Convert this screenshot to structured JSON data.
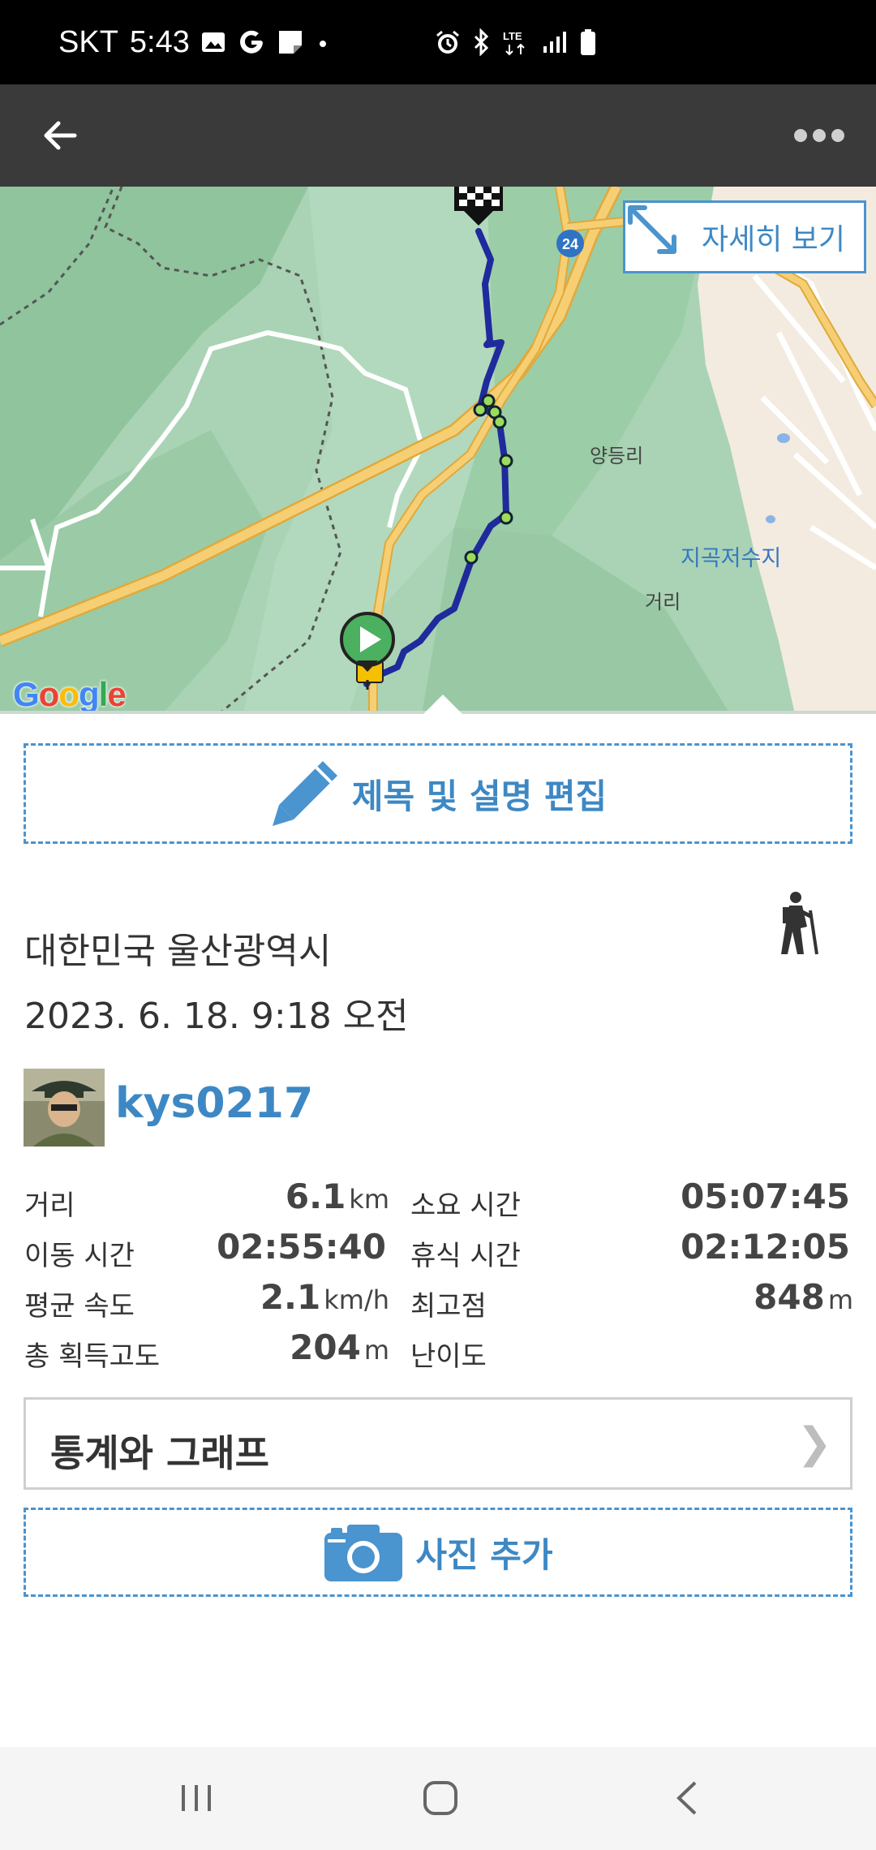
{
  "status": {
    "carrier": "SKT",
    "time": "5:43",
    "network": "LTE"
  },
  "map": {
    "detail_label": "자세히 보기",
    "road_number": "24",
    "place_labels": [
      "양등리",
      "지곡저수지",
      "거리"
    ],
    "google_letters": [
      "G",
      "o",
      "o",
      "g",
      "l",
      "e"
    ]
  },
  "actions": {
    "edit_label": "제목 및 설명 편집",
    "photo_label": "사진 추가"
  },
  "activity": {
    "location": "대한민국 울산광역시",
    "datetime": "2023. 6. 18. 9:18 오전",
    "username": "kys0217"
  },
  "stats": [
    {
      "label": "거리",
      "value": "6.1",
      "unit": "km",
      "label2": "소요 시간",
      "value2": "05:07:45",
      "unit2": ""
    },
    {
      "label": "이동 시간",
      "value": "02:55:40",
      "unit": "",
      "label2": "휴식 시간",
      "value2": "02:12:05",
      "unit2": ""
    },
    {
      "label": "평균 속도",
      "value": "2.1",
      "unit": "km/h",
      "label2": "최고점",
      "value2": "848",
      "unit2": "m"
    },
    {
      "label": "총 획득고도",
      "value": "204",
      "unit": "m",
      "label2": "난이도",
      "value2": "",
      "unit2": ""
    }
  ],
  "graph": {
    "label": "통계와 그래프",
    "chevron": "❯"
  },
  "colors": {
    "accent": "#3d88c4",
    "route": "#1f2a9c",
    "map_green": "#a9d3b4",
    "road": "#f2c15f"
  }
}
